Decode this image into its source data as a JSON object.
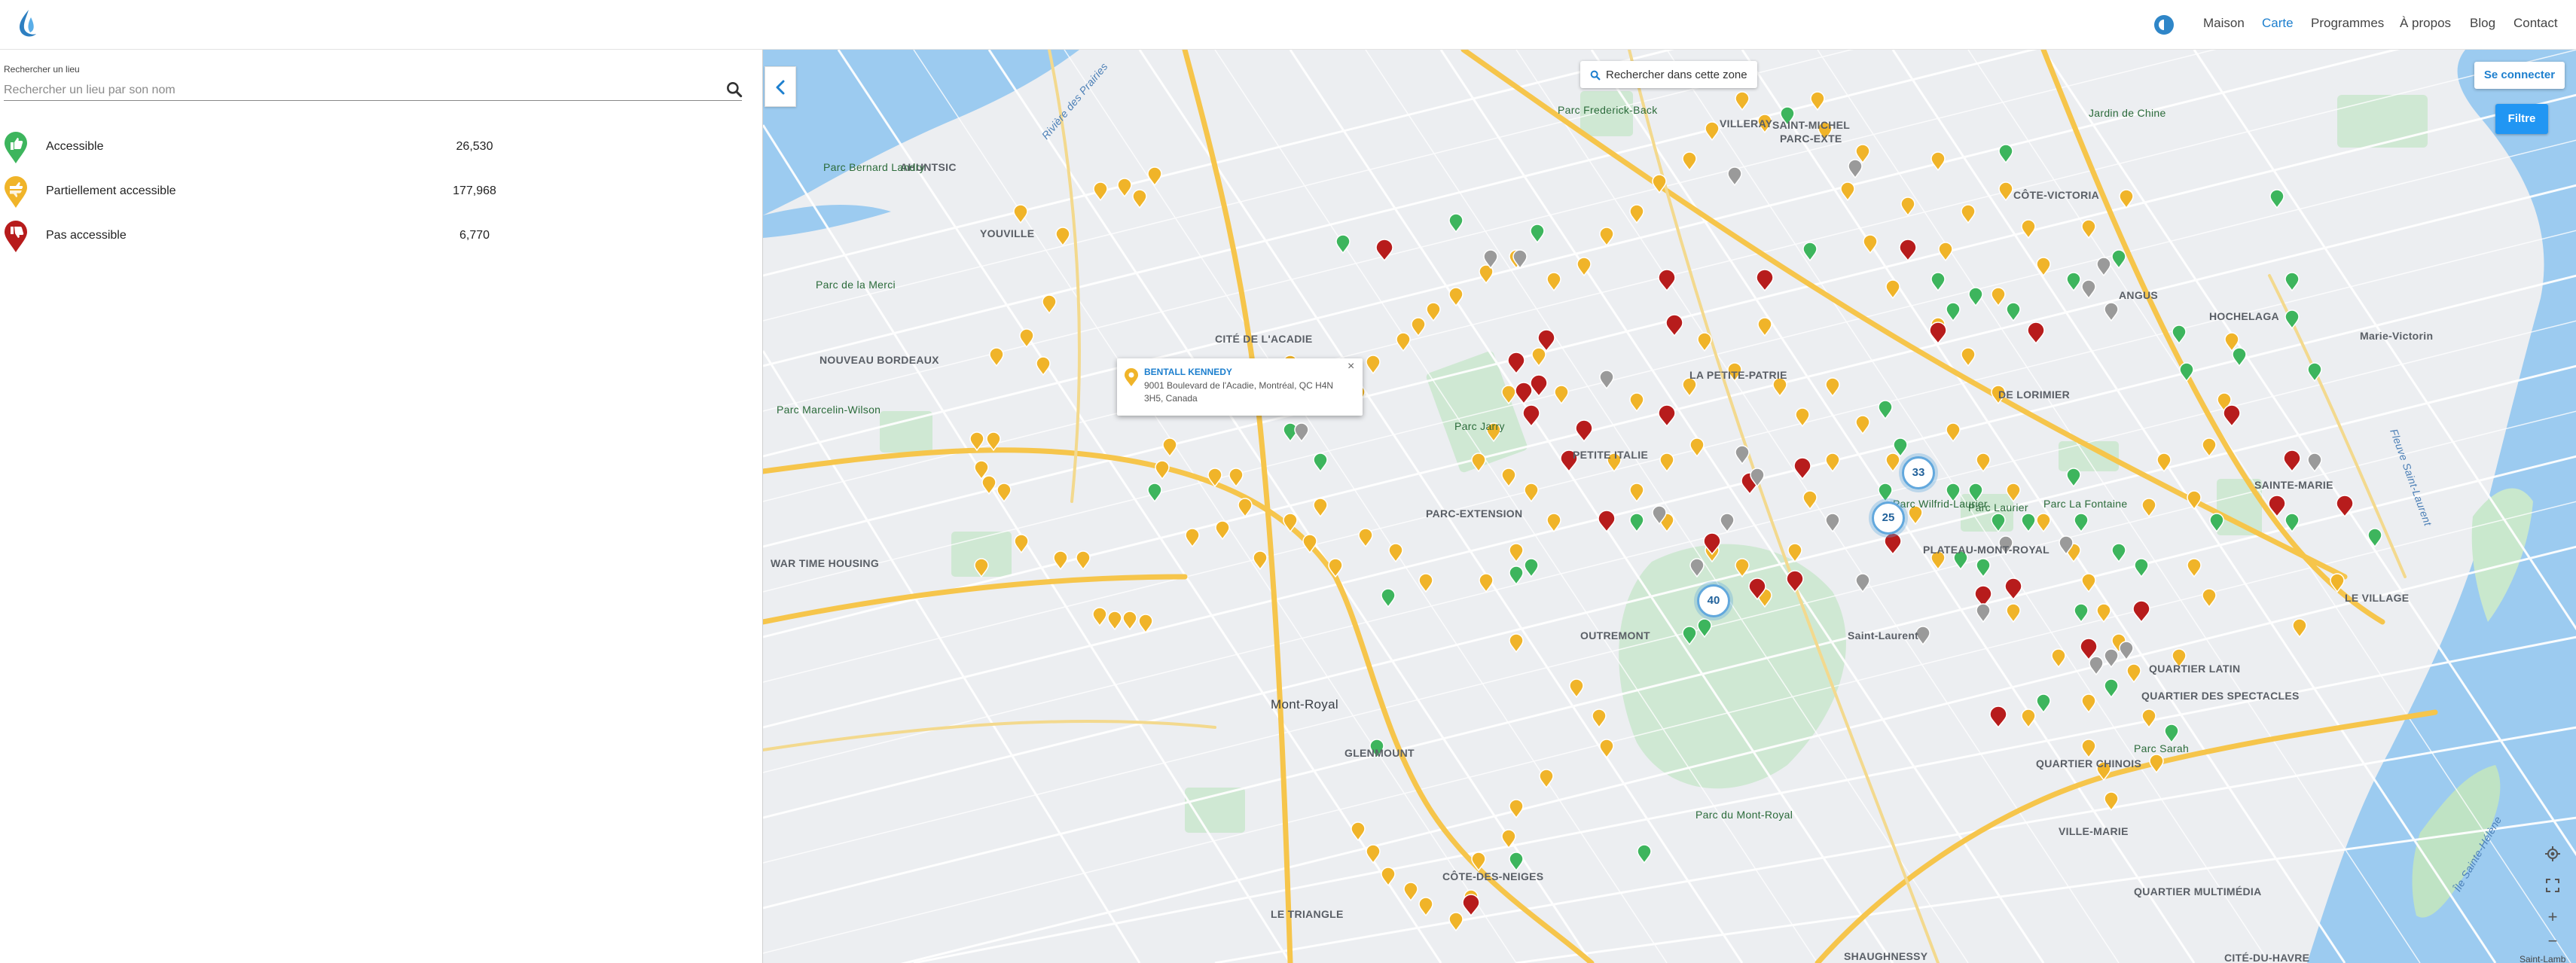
{
  "nav": {
    "links": [
      {
        "label": "Maison",
        "active": false
      },
      {
        "label": "Carte",
        "active": true
      },
      {
        "label": "Programmes",
        "active": false
      },
      {
        "label": "À propos",
        "active": false
      },
      {
        "label": "Blog",
        "active": false
      },
      {
        "label": "Contact",
        "active": false
      }
    ],
    "logo_icon": "drop-logo-icon",
    "theme_icon": "contrast-icon"
  },
  "search": {
    "label": "Rechercher un lieu",
    "placeholder": "Rechercher un lieu par son nom",
    "value": "",
    "icon": "search-icon"
  },
  "legend": [
    {
      "key": "accessible",
      "label": "Accessible",
      "count": "26,530",
      "color": "#3db55d",
      "icon": "thumbs-up-pin-icon"
    },
    {
      "key": "partial",
      "label": "Partiellement accessible",
      "count": "177,968",
      "color": "#f0b429",
      "icon": "partial-pin-icon"
    },
    {
      "key": "not",
      "label": "Pas accessible",
      "count": "6,770",
      "color": "#b71c1c",
      "icon": "thumbs-down-pin-icon"
    }
  ],
  "map": {
    "search_area_label": "Rechercher dans cette zone",
    "login_label": "Se connecter",
    "filter_label": "Filtre",
    "popup": {
      "name": "BENTALL KENNEDY",
      "address": "9001 Boulevard de l'Acadie, Montréal, QC H4N 3H5, Canada",
      "close": "×"
    },
    "clusters": [
      "33",
      "25",
      "40"
    ],
    "labels": {
      "ahuntsic": "AHUNTSIC",
      "youville": "YOUVILLE",
      "villeray": "VILLERAY",
      "stmichel": "SAINT-MICHEL",
      "parcext_nord": "PARC-EXTE",
      "cote_vertu": "CÔTE-VICTORIA",
      "montreal_chinois": "Jardin de Chine",
      "nouveau_bordeaux": "NOUVEAU BORDEAUX",
      "cite_acadie": "CITÉ DE L'ACADIE",
      "petite_patrie": "LA PETITE-PATRIE",
      "petite_italie": "PETITE ITALIE",
      "parc_ext": "PARC-EXTENSION",
      "plateau": "PLATEAU-MONT-ROYAL",
      "mont_royal": "Mont-Royal",
      "outremont": "OUTREMONT",
      "glenmount": "GLENMOUNT",
      "triangle": "LE TRIANGLE",
      "cote_des_neiges": "CÔTE-DES-NEIGES",
      "hochelaga": "HOCHELAGA",
      "marie_victorin": "Marie-Victorin",
      "angus": "ANGUS",
      "village": "LE VILLAGE",
      "quartier_latin": "QUARTIER LATIN",
      "spectacles": "QUARTIER DES SPECTACLES",
      "chinatown": "QUARTIER CHINOIS",
      "ville_marie": "VILLE-MARIE",
      "multimedia": "QUARTIER MULTIMÉDIA",
      "cite_havre": "CITÉ-DU-HAVRE",
      "shaughnessy": "SHAUGHNESSY",
      "war_time": "WAR TIME HOUSING",
      "sainte_marie": "SAINTE-MARIE",
      "parc_mont_royal": "Parc du Mont-Royal",
      "parc_jarry": "Parc Jarry",
      "parc_lafontaine": "Parc La Fontaine",
      "rivieres_prairies": "Rivière des Prairies",
      "fleuve": "Fleuve Saint-Laurent",
      "ile_ste_helene": "Île Sainte-Hélène",
      "parc_marcelin": "Parc Marcelin-Wilson",
      "parc_frederick": "Parc Frederick-Back",
      "parc_laurier": "Parc Laurier",
      "parc_sarah": "Parc Sarah",
      "parc_de_la_merci": "Parc de la Merci",
      "parc_bernard": "Parc Bernard Landry",
      "saint_laurent": "Saint-Laurent",
      "centre_laurier": "Parc Wilfrid-Laurier",
      "de_lorimier": "DE LORIMIER",
      "cite_jardin": "SAINT-MICHEL PARC-EXTE"
    },
    "controls": {
      "locate_icon": "crosshair-icon",
      "fullscreen_icon": "fullscreen-icon",
      "zoom_in": "+",
      "zoom_out": "−"
    },
    "attribution": "Saint-Lamb"
  }
}
